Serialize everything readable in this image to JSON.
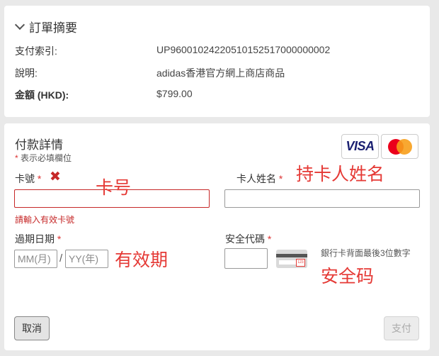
{
  "summary": {
    "title": "訂單摘要",
    "rows": [
      {
        "label": "支付索引:",
        "value": "UP96001024220510152517000000002"
      },
      {
        "label": "說明:",
        "value": "adidas香港官方網上商店商品"
      },
      {
        "label": "金額 (HKD):",
        "value": "$799.00"
      }
    ]
  },
  "payment": {
    "title": "付款詳情",
    "required_star": "*",
    "required_note": "表示必填欄位",
    "brands": {
      "visa": "VISA",
      "mastercard_icon": "mastercard-logo"
    },
    "card_number": {
      "label": "卡號",
      "value": "",
      "error": "請輸入有效卡號",
      "error_icon": "✖"
    },
    "cardholder": {
      "label": "卡人姓名",
      "value": ""
    },
    "expiry": {
      "label": "過期日期",
      "month_placeholder": "MM(月)",
      "year_placeholder": "YY(年)",
      "separator": "/"
    },
    "cvv": {
      "label": "安全代碼",
      "value": "",
      "hint": "銀行卡背面最後3位數字",
      "icon": "card-back-cvv-icon",
      "code_mark": "123"
    },
    "buttons": {
      "cancel": "取消",
      "pay": "支付"
    }
  },
  "annotations": {
    "card_number": "卡号",
    "cardholder": "持卡人姓名",
    "expiry": "有效期",
    "cvv": "安全码"
  },
  "colors": {
    "error": "#c62828",
    "annotation": "#e53935",
    "visa": "#1a1f71"
  }
}
